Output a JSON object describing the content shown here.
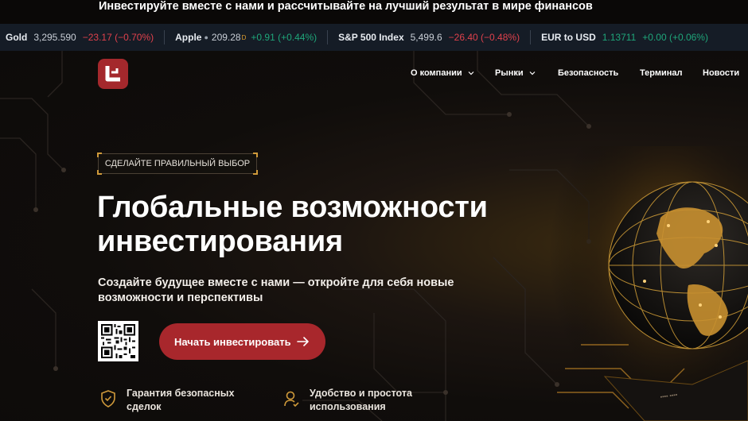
{
  "promo": {
    "text": "Инвестируйте вместе с нами и рассчитывайте на лучший результат в мире финансов"
  },
  "ticker": [
    {
      "symbol": "Gold",
      "price": "3,295.590",
      "change": "−23.17 (−0.70%)",
      "direction": "down"
    },
    {
      "symbol": "Apple",
      "price": "209.28",
      "marker": "D",
      "change": "+0.91 (+0.44%)",
      "direction": "up"
    },
    {
      "symbol": "S&P 500 Index",
      "price": "5,499.6",
      "change": "−26.40 (−0.48%)",
      "direction": "down"
    },
    {
      "symbol": "EUR to USD",
      "price": "1.13711",
      "change": "+0.00 (+0.06%)",
      "direction": "up"
    }
  ],
  "nav": {
    "items": [
      {
        "label": "О компании",
        "has_dropdown": true
      },
      {
        "label": "Рынки",
        "has_dropdown": true
      },
      {
        "label": "Безопасность",
        "has_dropdown": false
      },
      {
        "label": "Терминал",
        "has_dropdown": false
      },
      {
        "label": "Новости",
        "has_dropdown": false
      }
    ]
  },
  "hero": {
    "badge": "СДЕЛАЙТЕ ПРАВИЛЬНЫЙ ВЫБОР",
    "title_line1": "Глобальные возможности",
    "title_line2": "инвестирования",
    "subtitle_line1": "Создайте будущее вместе с нами — откройте для себя новые",
    "subtitle_line2": "возможности и перспективы",
    "cta_label": "Начать инвестировать"
  },
  "features": [
    {
      "icon": "shield-check-icon",
      "line1": "Гарантия безопасных",
      "line2": "сделок"
    },
    {
      "icon": "user-support-icon",
      "line1": "Удобство и простота",
      "line2": "использования"
    }
  ],
  "colors": {
    "accent": "#a8272c",
    "gold": "#d09a3a",
    "ticker_bg": "#151c26",
    "up": "#1fa67a",
    "down": "#e0414c"
  }
}
